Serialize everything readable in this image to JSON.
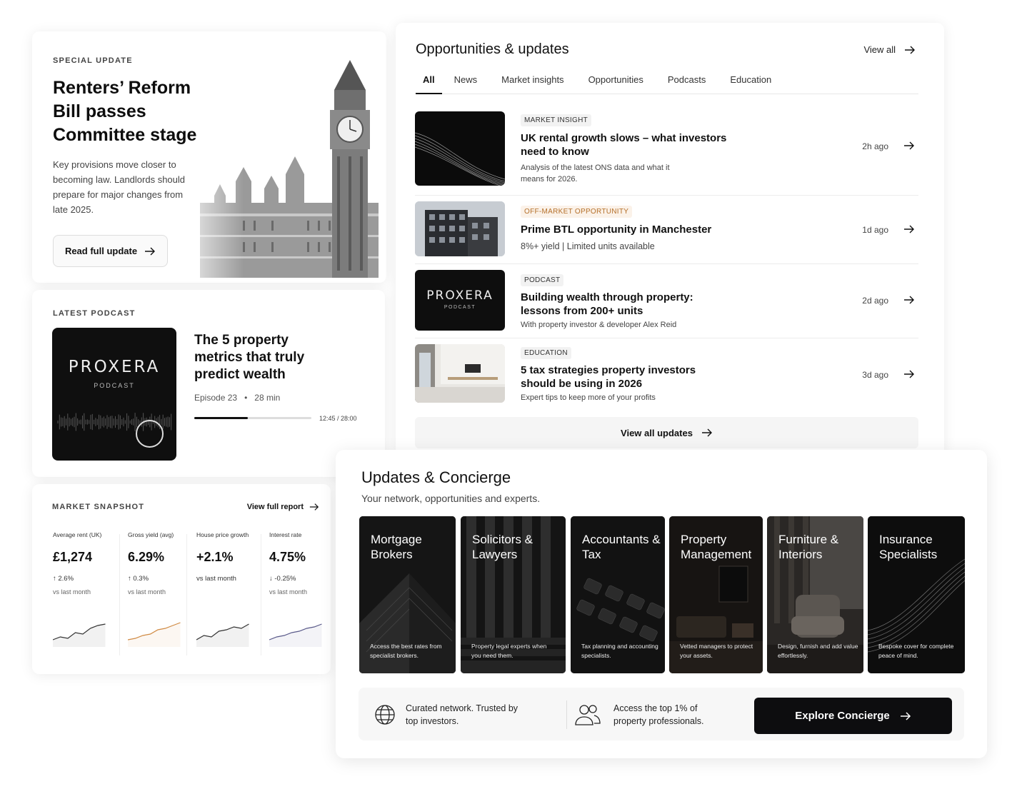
{
  "special": {
    "eyebrow": "SPECIAL UPDATE",
    "title": "Renters’ Reform Bill passes Committee stage",
    "body": "Key provisions move closer to becoming law. Landlords should prepare for major changes from late 2025.",
    "button": "Read full update"
  },
  "podcast": {
    "eyebrow": "LATEST PODCAST",
    "brand": "PROXERA",
    "brand_sub": "PODCAST",
    "title": "The 5 property metrics that truly predict wealth",
    "episode": "Episode 23",
    "sep": "•",
    "duration": "28 min",
    "time": "12:45 / 28:00",
    "progress": 0.455
  },
  "market": {
    "eyebrow": "MARKET SNAPSHOT",
    "view_report": "View full report",
    "metrics": [
      {
        "label": "Average rent (UK)",
        "value": "£1,274",
        "change": "↑ 2.6%",
        "vs": "vs last month",
        "color": "#333333"
      },
      {
        "label": "Gross yield (avg)",
        "value": "6.29%",
        "change": "↑ 0.3%",
        "vs": "vs last month",
        "color": "#d08a43"
      },
      {
        "label": "House price growth",
        "value": "+2.1%",
        "change": "vs last month",
        "vs": "",
        "color": "#333333"
      },
      {
        "label": "Interest rate",
        "value": "4.75%",
        "change": "↓ -0.25%",
        "vs": "vs last month",
        "color": "#5a5a8a"
      }
    ]
  },
  "opps": {
    "title": "Opportunities & updates",
    "view_all": "View all",
    "tabs": [
      "All",
      "News",
      "Market insights",
      "Opportunities",
      "Podcasts",
      "Education"
    ],
    "items": [
      {
        "tag": "MARKET INSIGHT",
        "title": "UK rental growth slows – what investors need to know",
        "desc": "Analysis of the latest ONS data and what it means for 2026.",
        "ago": "2h ago"
      },
      {
        "tag": "OFF-MARKET OPPORTUNITY",
        "title": "Prime BTL opportunity in Manchester",
        "desc": "8%+ yield | Limited units available",
        "ago": "1d ago"
      },
      {
        "tag": "PODCAST",
        "title": "Building wealth through property: lessons from 200+ units",
        "desc": "With property investor & developer Alex Reid",
        "ago": "2d ago",
        "brand": "PROXERA",
        "brand_sub": "PODCAST"
      },
      {
        "tag": "EDUCATION",
        "title": "5 tax strategies property investors should be using in 2026",
        "desc": "Expert tips to keep more of your profits",
        "ago": "3d ago"
      }
    ],
    "view_all_updates": "View all updates"
  },
  "concierge": {
    "title": "Updates & Concierge",
    "subtitle": "Your network, opportunities and experts.",
    "tiles": [
      {
        "title": "Mortgage Brokers",
        "desc": "Access the best rates from specialist brokers."
      },
      {
        "title": "Solicitors & Lawyers",
        "desc": "Property legal experts when you need them."
      },
      {
        "title": "Accountants & Tax",
        "desc": "Tax planning and accounting specialists."
      },
      {
        "title": "Property Management",
        "desc": "Vetted managers to protect your assets."
      },
      {
        "title": "Furniture & Interiors",
        "desc": "Design, furnish and add value effortlessly."
      },
      {
        "title": "Insurance Specialists",
        "desc": "Bespoke cover for complete peace of mind."
      }
    ],
    "footer_1": "Curated network. Trusted by top investors.",
    "footer_2": "Access the top 1% of property professionals.",
    "explore": "Explore Concierge"
  }
}
